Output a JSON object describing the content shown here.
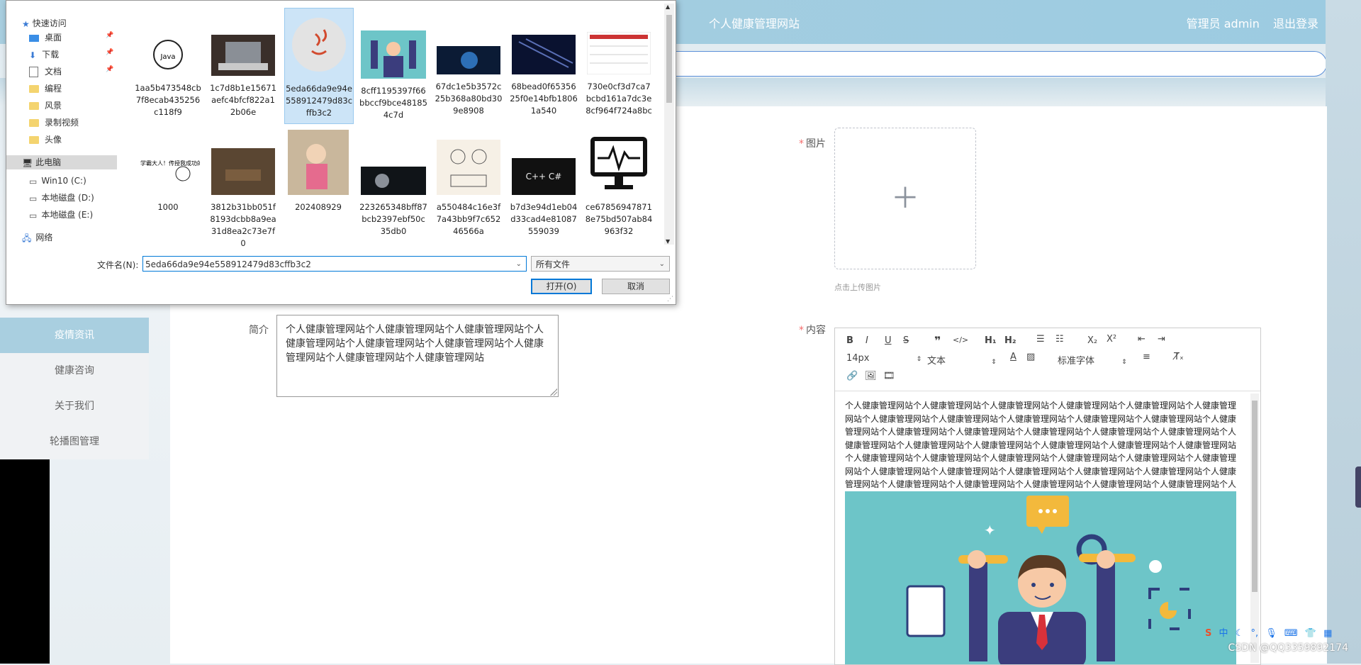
{
  "app": {
    "title": "个人健康管理网站",
    "user_label": "管理员 admin",
    "logout": "退出登录"
  },
  "menu": {
    "items": [
      {
        "label": "疫情资讯",
        "active": true
      },
      {
        "label": "健康咨询"
      },
      {
        "label": "关于我们"
      },
      {
        "label": "轮播图管理"
      }
    ]
  },
  "form": {
    "image_label": "图片",
    "upload_hint": "点击上传图片",
    "intro_label": "简介",
    "intro_value": "个人健康管理网站个人健康管理网站个人健康管理网站个人健康管理网站个人健康管理网站个人健康管理网站个人健康管理网站个人健康管理网站个人健康管理网站",
    "content_label": "内容"
  },
  "editor": {
    "font_size": "14px",
    "block_type": "文本",
    "font_family": "标准字体",
    "content_text": "个人健康管理网站个人健康管理网站个人健康管理网站个人健康管理网站个人健康管理网站个人健康管理网站个人健康管理网站个人健康管理网站个人健康管理网站个人健康管理网站个人健康管理网站个人健康管理网站个人健康管理网站个人健康管理网站个人健康管理网站个人健康管理网站个人健康管理网站个人健康管理网站个人健康管理网站个人健康管理网站个人健康管理网站个人健康管理网站个人健康管理网站个人健康管理网站个人健康管理网站个人健康管理网站个人健康管理网站个人健康管理网站个人健康管理网站个人健康管理网站个人健康管理网站个人健康管理网站个人健康管理网站个人健康管理网站个人健康管理网站个人健康管理网站个人健康管理网站个人健康管理网站个人健康管理网站个人健康管理网站个人健康管理网站"
  },
  "dialog": {
    "nav": {
      "quick_access": "快速访问",
      "items": [
        "桌面",
        "下载",
        "文档",
        "编程",
        "风景",
        "录制视频",
        "头像"
      ],
      "this_pc": "此电脑",
      "drives": [
        "Win10 (C:)",
        "本地磁盘 (D:)",
        "本地磁盘 (E:)"
      ],
      "network": "网络"
    },
    "files": [
      "1aa5b473548cb7f8ecab435256c118f9",
      "1c7d8b1e15671aefc4bfcf822a12b06e",
      "5eda66da9e94e558912479d83cffb3c2",
      "8cff1195397f66bbccf9bce481854c7d",
      "67dc1e5b3572c25b368a80bd309e8908",
      "68bead0f6535625f0e14bfb18061a540",
      "730e0cf3d7ca7bcbd161a7dc3e8cf964f724a8bc",
      "1000",
      "3812b31bb051f8193dcbb8a9ea31d8ea2c73e7f0",
      "202408929",
      "223265348bff87bcb2397ebf50c35db0",
      "a550484c16e3f7a43bb9f7c65246566a",
      "b7d3e94d1eb04d33cad4e81087559039",
      "ce678569478718e75bd507ab84963f32"
    ],
    "thumb_texts": {
      "java": "Java",
      "book": "学霸大人！传授我成功的秘诀吧",
      "cpp": "C++ C#"
    },
    "filename_label": "文件名(N):",
    "filename_value": "5eda66da9e94e558912479d83cffb3c2",
    "filetype_value": "所有文件",
    "open_button": "打开(O)",
    "cancel_button": "取消"
  },
  "tray": {
    "ime": "中",
    "watermark": "CSDN @QQ3359892174"
  },
  "colors": {
    "header": "#a9cfe0",
    "accent": "#0078d7",
    "required": "#f56c6c"
  }
}
